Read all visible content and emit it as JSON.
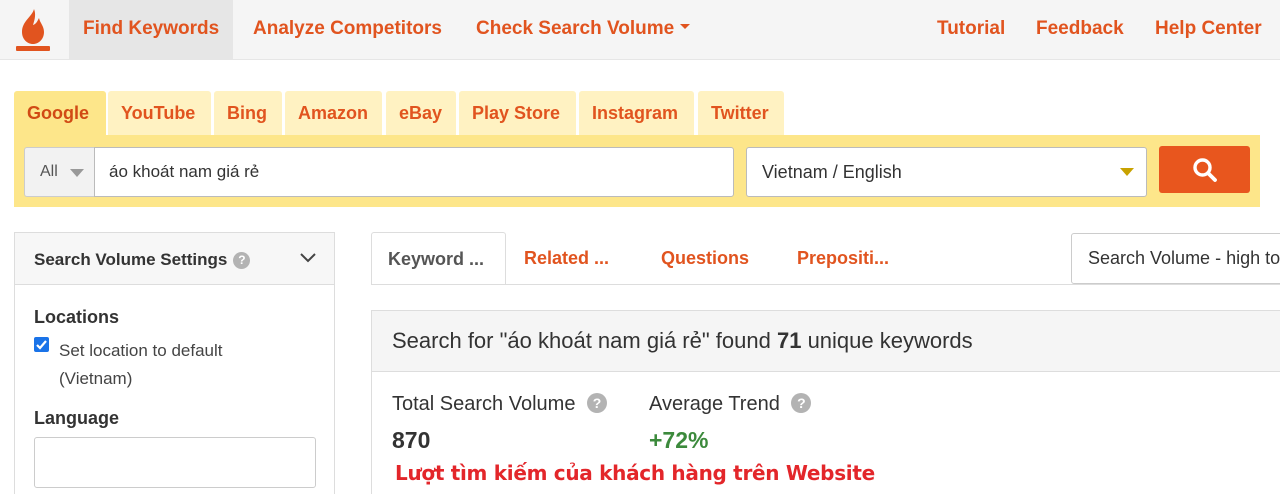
{
  "nav": {
    "items": [
      {
        "label": "Find Keywords",
        "active": true
      },
      {
        "label": "Analyze Competitors"
      },
      {
        "label": "Check Search Volume",
        "dropdown": true
      }
    ],
    "right_items": [
      {
        "label": "Tutorial"
      },
      {
        "label": "Feedback"
      },
      {
        "label": "Help Center"
      }
    ]
  },
  "engines": [
    "Google",
    "YouTube",
    "Bing",
    "Amazon",
    "eBay",
    "Play Store",
    "Instagram",
    "Twitter"
  ],
  "search": {
    "scope": "All",
    "query": "áo khoát nam giá rẻ",
    "location": "Vietnam / English",
    "button_icon": "search-icon"
  },
  "settings": {
    "title": "Search Volume Settings",
    "locations_label": "Locations",
    "set_default_label": "Set location to default (Vietnam)",
    "set_default_checked": true,
    "language_label": "Language",
    "language_value": ""
  },
  "result_tabs": [
    "Keyword ...",
    "Related ...",
    "Questions",
    "Prepositi..."
  ],
  "sort": {
    "value": "Search Volume - high to low"
  },
  "results": {
    "prefix": "Search for \"áo khoát nam giá rẻ\" found ",
    "count": "71",
    "suffix": " unique keywords",
    "total_label": "Total Search Volume",
    "total_value": "870",
    "trend_label": "Average Trend",
    "trend_value": "+72%",
    "trend_color": "#3c8a3c",
    "annotation": "Lượt tìm kiếm của khách hàng trên Website"
  },
  "colors": {
    "accent": "#e1541f",
    "tab_bg": "#fff2c2",
    "tab_active": "#fde68a",
    "annotation": "#e3262a"
  }
}
